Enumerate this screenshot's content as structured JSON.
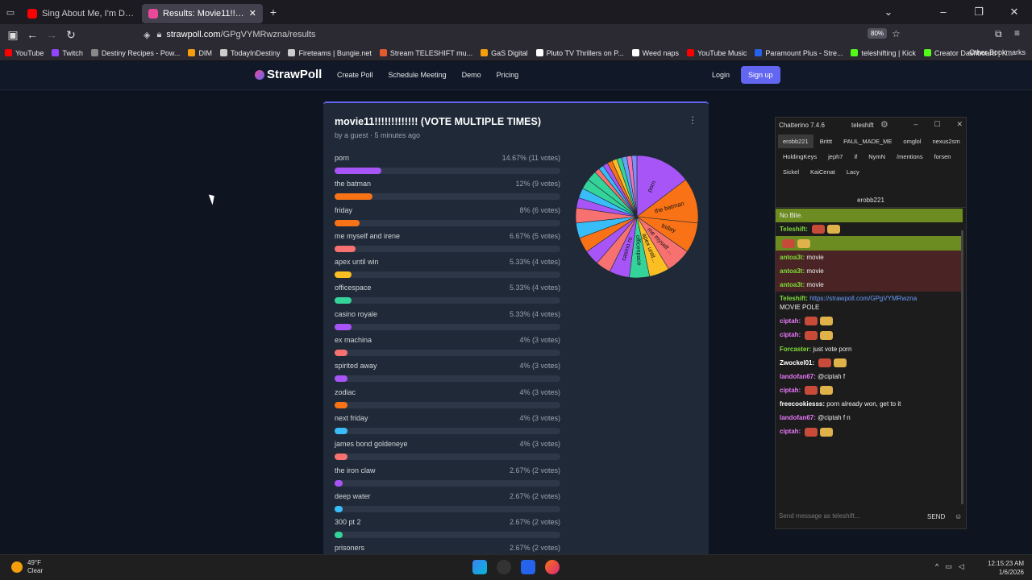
{
  "browser": {
    "tabs": [
      {
        "title": "Sing About Me, I'm Dying Of Thirst",
        "active": false,
        "color": "#ff0000"
      },
      {
        "title": "Results: Movie11!!!!!!!!!!!!! (VOTE",
        "active": true,
        "color": "#ec4899"
      }
    ],
    "url_host": "strawpoll.com",
    "url_path": "/GPgVYMRwzna/results",
    "zoom": "80%",
    "bookmarks": [
      {
        "label": "YouTube",
        "color": "#ff0000"
      },
      {
        "label": "Twitch",
        "color": "#9146ff"
      },
      {
        "label": "Destiny Recipes - Pow...",
        "color": "#888888"
      },
      {
        "label": "DIM",
        "color": "#f59e0b"
      },
      {
        "label": "TodayInDestiny",
        "color": "#cccccc"
      },
      {
        "label": "Fireteams | Bungie.net",
        "color": "#cccccc"
      },
      {
        "label": "Stream TELESHIFT mu...",
        "color": "#e25b30"
      },
      {
        "label": "GaS Digital",
        "color": "#f59e0b"
      },
      {
        "label": "Pluto TV Thrillers on P...",
        "color": "#ffffff"
      },
      {
        "label": "Weed naps",
        "color": "#ffffff"
      },
      {
        "label": "YouTube Music",
        "color": "#ff0000"
      },
      {
        "label": "Paramount Plus - Stre...",
        "color": "#2563eb"
      },
      {
        "label": "teleshifting | Kick",
        "color": "#53fc18"
      },
      {
        "label": "Creator Dashboard | K...",
        "color": "#53fc18"
      }
    ],
    "other_bookmarks": "Other Bookmarks"
  },
  "site": {
    "logo": "StrawPoll",
    "nav": [
      "Create Poll",
      "Schedule Meeting",
      "Demo",
      "Pricing"
    ],
    "login": "Login",
    "signup": "Sign up"
  },
  "poll": {
    "title": "movie11!!!!!!!!!!!!! (VOTE MULTIPLE TIMES)",
    "meta": "by a guest · 5 minutes ago",
    "results": [
      {
        "name": "porn",
        "pct": "14.67% (11 votes)",
        "share": 14.67,
        "color": "#a855f7"
      },
      {
        "name": "the batman",
        "pct": "12% (9 votes)",
        "share": 12,
        "color": "#f97316"
      },
      {
        "name": "friday",
        "pct": "8% (6 votes)",
        "share": 8,
        "color": "#f97316"
      },
      {
        "name": "me myself and irene",
        "pct": "6.67% (5 votes)",
        "share": 6.67,
        "color": "#f87171"
      },
      {
        "name": "apex until win",
        "pct": "5.33% (4 votes)",
        "share": 5.33,
        "color": "#fbbf24"
      },
      {
        "name": "officespace",
        "pct": "5.33% (4 votes)",
        "share": 5.33,
        "color": "#34d399"
      },
      {
        "name": "casino royale",
        "pct": "5.33% (4 votes)",
        "share": 5.33,
        "color": "#a855f7"
      },
      {
        "name": "ex machina",
        "pct": "4% (3 votes)",
        "share": 4,
        "color": "#f87171"
      },
      {
        "name": "spirited away",
        "pct": "4% (3 votes)",
        "share": 4,
        "color": "#a855f7"
      },
      {
        "name": "zodiac",
        "pct": "4% (3 votes)",
        "share": 4,
        "color": "#f97316"
      },
      {
        "name": "next friday",
        "pct": "4% (3 votes)",
        "share": 4,
        "color": "#38bdf8"
      },
      {
        "name": "james bond goldeneye",
        "pct": "4% (3 votes)",
        "share": 4,
        "color": "#f87171"
      },
      {
        "name": "the iron claw",
        "pct": "2.67% (2 votes)",
        "share": 2.67,
        "color": "#a855f7"
      },
      {
        "name": "deep water",
        "pct": "2.67% (2 votes)",
        "share": 2.67,
        "color": "#38bdf8"
      },
      {
        "name": "300 pt 2",
        "pct": "2.67% (2 votes)",
        "share": 2.67,
        "color": "#34d399"
      },
      {
        "name": "prisoners",
        "pct": "2.67% (2 votes)",
        "share": 2.67,
        "color": "#34d399"
      }
    ],
    "pie_labels": [
      "porn",
      "the batman",
      "friday",
      "me myself ...",
      "apex until...",
      "officespace",
      "casino ro"
    ],
    "pie_other_colors": [
      "#f87171",
      "#38bdf8",
      "#a855f7",
      "#f97316",
      "#fbbf24",
      "#34d399",
      "#60a5fa",
      "#f472b6",
      "#818cf8"
    ]
  },
  "chat": {
    "app": "Chatterino 7.4.6",
    "user": "teleshift",
    "tabs": [
      "erobb221",
      "Brittt",
      "PAUL_MADE_ME",
      "omglol",
      "nexus2sm",
      "HoldingKeys",
      "jeph7",
      "if",
      "NymN",
      "/mentions",
      "forsen",
      "Sickel",
      "KaiCenat",
      "Lacy"
    ],
    "channel": "erobb221",
    "messages": [
      {
        "user": "",
        "text": "No Bite.",
        "style": "hl-green",
        "ucolor": "#ffffff"
      },
      {
        "user": "Teleshift:",
        "text": "",
        "style": "",
        "ucolor": "#7fdc3a"
      },
      {
        "user": "",
        "text": "",
        "style": "hl-green",
        "ucolor": "#ffffff"
      },
      {
        "user": "antoa3t:",
        "text": "movie",
        "style": "hl-red",
        "ucolor": "#7fdc3a"
      },
      {
        "user": "antoa3t:",
        "text": "movie",
        "style": "hl-red",
        "ucolor": "#7fdc3a"
      },
      {
        "user": "antoa3t:",
        "text": "movie",
        "style": "hl-red",
        "ucolor": "#7fdc3a"
      },
      {
        "user": "Teleshift:",
        "text": "https://strawpoll.com/GPgVYMRwzna",
        "extra": "MOVIE POLE",
        "style": "",
        "ucolor": "#7fdc3a",
        "link": true
      },
      {
        "user": "ciptah:",
        "text": "",
        "style": "",
        "ucolor": "#e879f9"
      },
      {
        "user": "ciptah:",
        "text": "",
        "style": "",
        "ucolor": "#e879f9"
      },
      {
        "user": "Forcaster:",
        "text": "just vote porn",
        "style": "",
        "ucolor": "#7fdc3a"
      },
      {
        "user": "Zwockel01:",
        "text": "",
        "style": "",
        "ucolor": "#ffffff"
      },
      {
        "user": "landofan67:",
        "text": "@ciptah f",
        "style": "",
        "ucolor": "#e879f9"
      },
      {
        "user": "ciptah:",
        "text": "",
        "style": "",
        "ucolor": "#e879f9"
      },
      {
        "user": "freecookiesss:",
        "text": "porn already won, get to it",
        "style": "",
        "ucolor": "#ffffff"
      },
      {
        "user": "landofan67:",
        "text": "@ciptah f n",
        "style": "",
        "ucolor": "#e879f9"
      },
      {
        "user": "ciptah:",
        "text": "",
        "style": "",
        "ucolor": "#e879f9"
      }
    ],
    "input_placeholder": "Send message as teleshift...",
    "send": "SEND"
  },
  "taskbar": {
    "temp": "49°F",
    "weather": "Clear",
    "time": "12:15:23 AM",
    "date": "1/6/2026"
  }
}
